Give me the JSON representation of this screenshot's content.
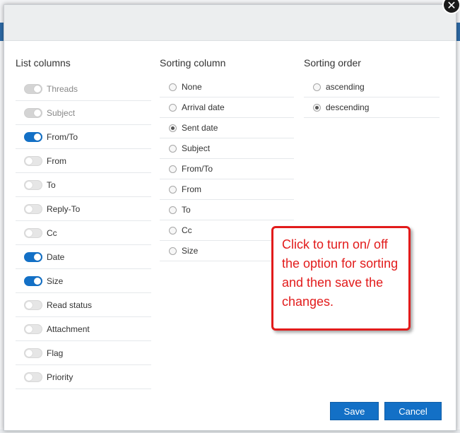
{
  "dialog": {
    "close_glyph": "✕"
  },
  "list_columns": {
    "title": "List columns",
    "items": [
      {
        "label": "Threads",
        "state": "locked"
      },
      {
        "label": "Subject",
        "state": "locked"
      },
      {
        "label": "From/To",
        "state": "on"
      },
      {
        "label": "From",
        "state": "off"
      },
      {
        "label": "To",
        "state": "off"
      },
      {
        "label": "Reply-To",
        "state": "off"
      },
      {
        "label": "Cc",
        "state": "off"
      },
      {
        "label": "Date",
        "state": "on"
      },
      {
        "label": "Size",
        "state": "on"
      },
      {
        "label": "Read status",
        "state": "off"
      },
      {
        "label": "Attachment",
        "state": "off"
      },
      {
        "label": "Flag",
        "state": "off"
      },
      {
        "label": "Priority",
        "state": "off"
      }
    ]
  },
  "sorting_column": {
    "title": "Sorting column",
    "selected": "Sent date",
    "options": [
      "None",
      "Arrival date",
      "Sent date",
      "Subject",
      "From/To",
      "From",
      "To",
      "Cc",
      "Size"
    ]
  },
  "sorting_order": {
    "title": "Sorting order",
    "selected": "descending",
    "options": [
      "ascending",
      "descending"
    ]
  },
  "callout": {
    "text": "Click to turn on/ off the option for sorting and then save the changes.",
    "color": "#e21b1b"
  },
  "buttons": {
    "save": "Save",
    "cancel": "Cancel"
  },
  "colors": {
    "accent": "#1370c6",
    "header_bar": "#2d6aa6"
  }
}
